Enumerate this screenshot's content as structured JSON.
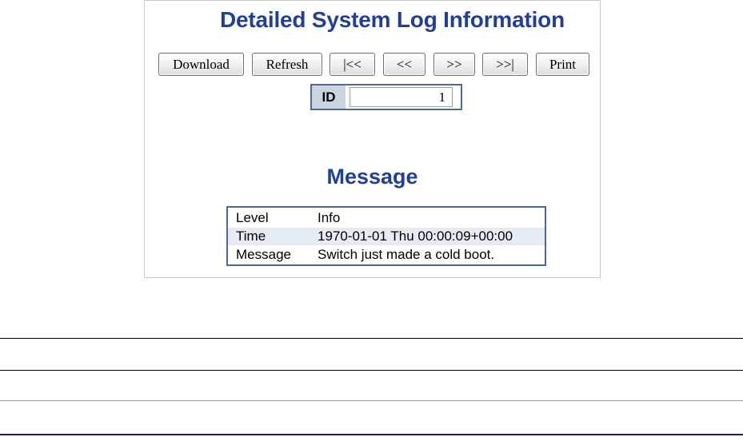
{
  "page": {
    "title": "Detailed System Log Information",
    "section_title": "Message"
  },
  "toolbar": {
    "download_label": "Download",
    "refresh_label": "Refresh",
    "first_label": "|<<",
    "prev_label": "<<",
    "next_label": ">>",
    "last_label": ">>|",
    "print_label": "Print"
  },
  "id_field": {
    "label": "ID",
    "value": "1"
  },
  "message": {
    "rows": [
      {
        "key": "Level",
        "value": "Info"
      },
      {
        "key": "Time",
        "value": "1970-01-01 Thu 00:00:09+00:00"
      },
      {
        "key": "Message",
        "value": "Switch just made a cold boot."
      }
    ]
  },
  "colors": {
    "title_blue": "#1f3f9a",
    "border_blue": "#4a6a9a",
    "row_alt": "#e6ecf3"
  }
}
